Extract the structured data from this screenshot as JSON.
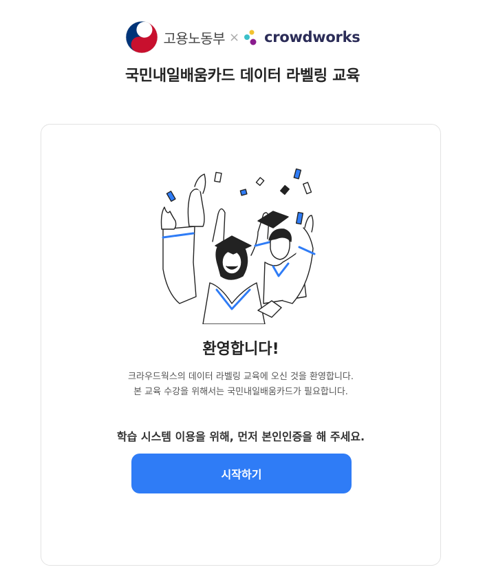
{
  "header": {
    "gov_logo_text": "고용노동부",
    "separator": "×",
    "partner_logo_text": "crowdworks",
    "title": "국민내일배움카드 데이터 라벨링 교육"
  },
  "card": {
    "illustration": "graduation-celebration-illustration",
    "welcome": "환영합니다!",
    "description_line1": "크라우드웍스의 데이터 라벨링 교육에 오신 것을 환영합니다.",
    "description_line2": "본 교육 수강을 위해서는 국민내일배움카드가 필요합니다.",
    "notice": "학습 시스템 이용을 위해, 먼저 본인인증을 해 주세요.",
    "start_button": "시작하기"
  },
  "colors": {
    "primary": "#2f7cf6",
    "brand_navy": "#2b2c57",
    "gov_red": "#c8102e",
    "gov_blue": "#003478"
  }
}
